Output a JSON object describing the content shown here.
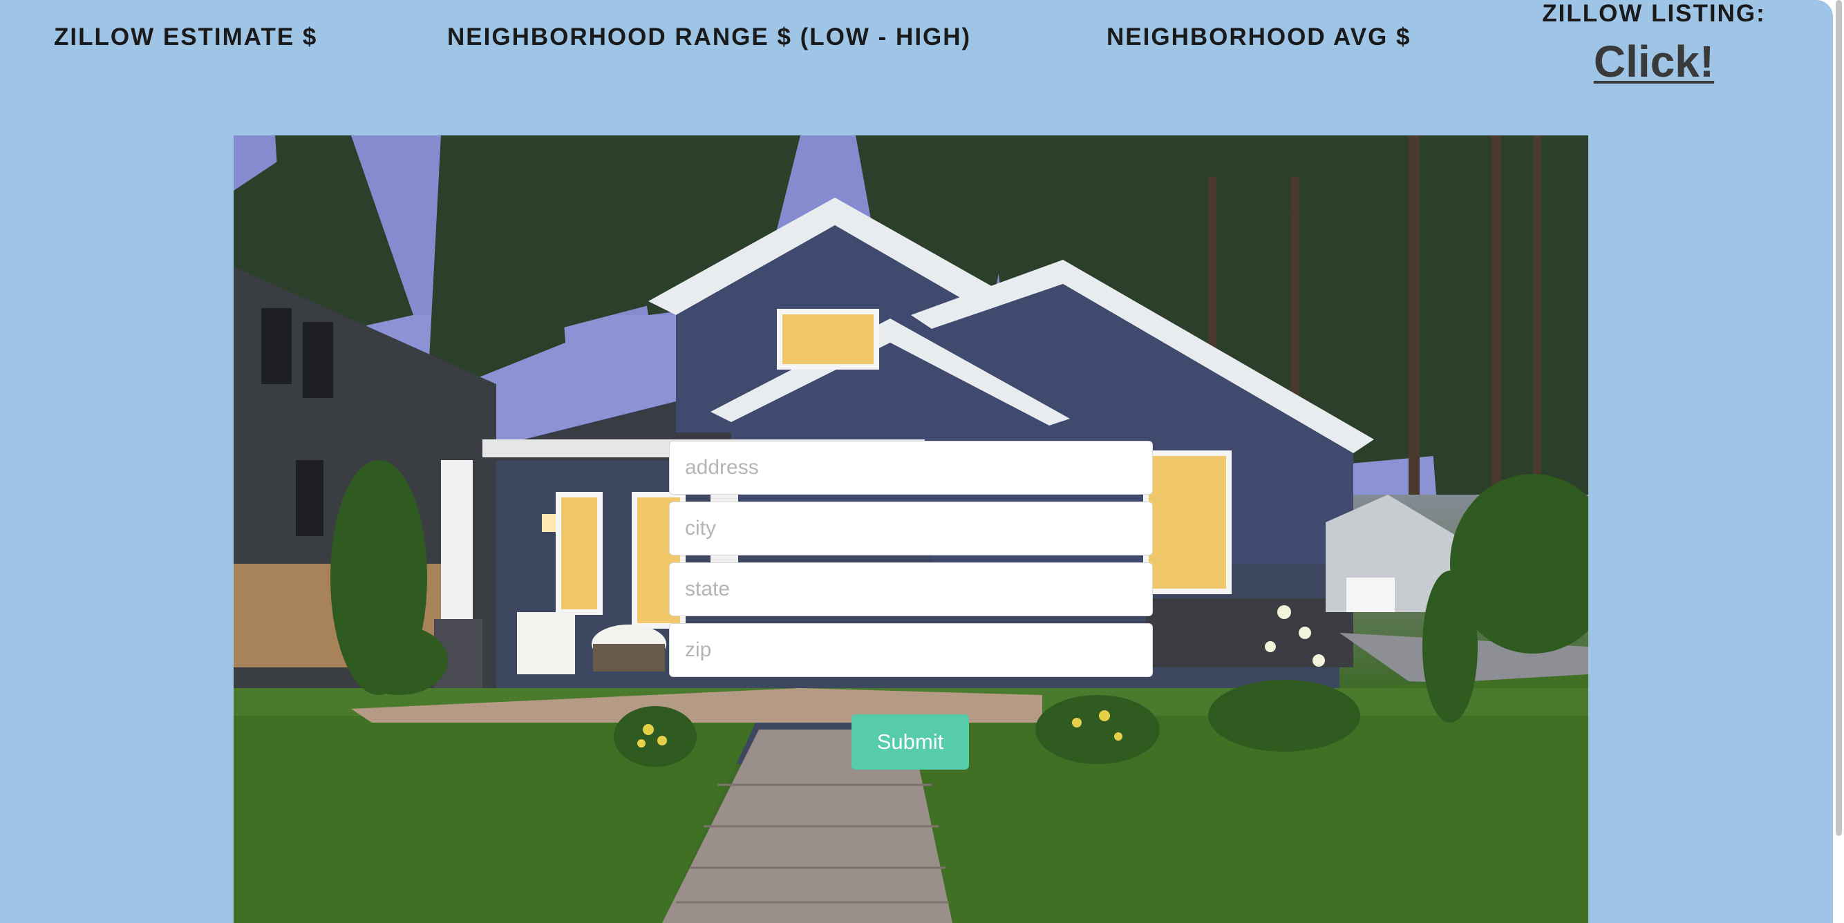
{
  "header": {
    "zillow_estimate_label": "ZILLOW ESTIMATE $",
    "neighborhood_range_label": "NEIGHBORHOOD RANGE $ (LOW - HIGH)",
    "neighborhood_avg_label": "NEIGHBORHOOD AVG $",
    "zillow_listing_label": "ZILLOW LISTING:",
    "zillow_listing_link": "Click!"
  },
  "form": {
    "address_placeholder": "address",
    "city_placeholder": "city",
    "state_placeholder": "state",
    "zip_placeholder": "zip",
    "submit_label": "Submit"
  },
  "colors": {
    "page_background": "#9fc5e6",
    "submit_button": "#56ccab"
  }
}
